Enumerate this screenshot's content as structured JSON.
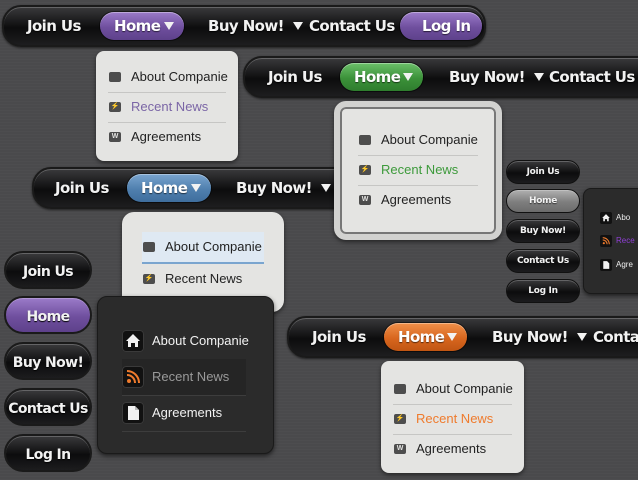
{
  "colors": {
    "background": "#4a4a4c",
    "purple": "#6f4f9e",
    "green": "#3b9139",
    "blue": "#4f7fae",
    "orange": "#d8661e",
    "highlight_purple": "#7b66a6",
    "highlight_green": "#3d9a3b",
    "highlight_orange": "#ef7b2d"
  },
  "menus": {
    "purple": {
      "join": "Join Us",
      "home": "Home",
      "buy": "Buy Now!",
      "contact": "Contact Us",
      "login": "Log In"
    },
    "green": {
      "join": "Join Us",
      "home": "Home",
      "buy": "Buy Now!",
      "contact": "Contact Us"
    },
    "blue": {
      "join": "Join Us",
      "home": "Home",
      "buy": "Buy Now!"
    },
    "orange": {
      "join": "Join Us",
      "home": "Home",
      "buy": "Buy Now!",
      "contact": "Contact"
    }
  },
  "dropdowns": {
    "gray_purple": [
      "About Companie",
      "Recent News",
      "Agreements"
    ],
    "gray_green": [
      "About Companie",
      "Recent News",
      "Agreements"
    ],
    "gray_blue": [
      "About Companie",
      "Recent News"
    ],
    "dark": [
      "About Companie",
      "Recent News",
      "Agreements"
    ],
    "gray_orange": [
      "About Companie",
      "Recent News",
      "Agreements"
    ],
    "mini_dark": [
      "Abo",
      "Rece",
      "Agre"
    ]
  },
  "vertical_large": [
    "Join Us",
    "Home",
    "Buy Now!",
    "Contact Us",
    "Log In"
  ],
  "vertical_small": [
    "Join Us",
    "Home",
    "Buy Now!",
    "Contact Us",
    "Log In"
  ],
  "icons": {
    "folder": "folder-icon",
    "lightning": "lightning-icon",
    "document": "document-icon",
    "home": "home-icon",
    "rss": "rss-icon",
    "page": "page-icon"
  }
}
